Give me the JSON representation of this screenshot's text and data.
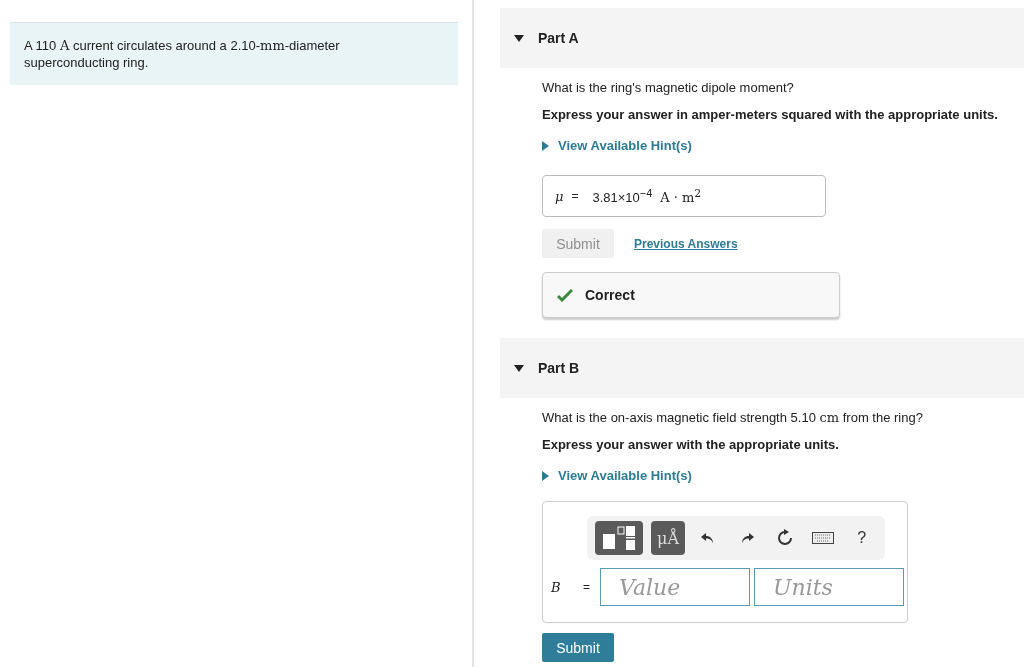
{
  "problem": {
    "segments": [
      {
        "kind": "plain",
        "text": "A 110 "
      },
      {
        "kind": "math",
        "text": "A"
      },
      {
        "kind": "plain",
        "text": " current circulates around a 2.10-"
      },
      {
        "kind": "math",
        "text": "mm"
      },
      {
        "kind": "plain",
        "text": "-diameter superconducting ring."
      }
    ]
  },
  "parts": [
    {
      "title": "Part A",
      "expanded": true,
      "question": [
        {
          "kind": "plain",
          "text": "What is the ring's magnetic dipole moment?"
        }
      ],
      "instruction": "Express your answer in amper-meters squared with the appropriate units.",
      "hint": "View Available Hint(s)",
      "answer": {
        "kind": "filled",
        "symbol": "μ",
        "equals": "=",
        "value": "3.81×10$^{−4}$",
        "unit": "A · m$^{2}$"
      },
      "submit": {
        "label": "Submit",
        "disabled": true
      },
      "previous": "Previous Answers",
      "feedback": {
        "label": "Correct",
        "correct": true
      }
    },
    {
      "title": "Part B",
      "expanded": true,
      "question": [
        {
          "kind": "plain",
          "text": "What is the on-axis magnetic field strength 5.10 "
        },
        {
          "kind": "math",
          "text": "cm"
        },
        {
          "kind": "plain",
          "text": " from the ring?"
        }
      ],
      "instruction": "Express your answer with the appropriate units.",
      "hint": "View Available Hint(s)",
      "answer": {
        "kind": "entry",
        "symbol": "B",
        "equals": "=",
        "value_placeholder": "Value",
        "units_placeholder": "Units",
        "toolbar": {
          "units_label": "μÅ",
          "help": "?"
        }
      },
      "submit": {
        "label": "Submit",
        "disabled": false
      }
    }
  ]
}
